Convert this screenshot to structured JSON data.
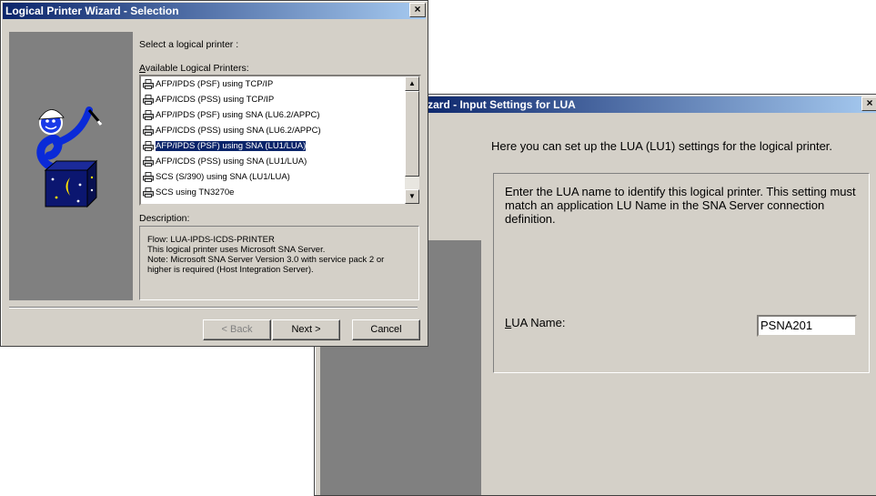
{
  "front_window": {
    "title": "Logical Printer Wizard - Selection",
    "close_glyph": "×",
    "prompt": "Select a logical printer :",
    "list_label_first": "A",
    "list_label_rest": "vailable Logical Printers:",
    "printers": [
      {
        "label": "AFP/IPDS (PSF) using TCP/IP",
        "selected": false
      },
      {
        "label": "AFP/ICDS (PSS) using TCP/IP",
        "selected": false
      },
      {
        "label": "AFP/IPDS (PSF) using SNA (LU6.2/APPC)",
        "selected": false
      },
      {
        "label": "AFP/ICDS (PSS) using SNA (LU6.2/APPC)",
        "selected": false
      },
      {
        "label": "AFP/IPDS (PSF) using SNA (LU1/LUA)",
        "selected": true
      },
      {
        "label": "AFP/ICDS (PSS) using SNA (LU1/LUA)",
        "selected": false
      },
      {
        "label": "SCS (S/390) using SNA (LU1/LUA)",
        "selected": false
      },
      {
        "label": "SCS using TN3270e",
        "selected": false
      }
    ],
    "description_label": "Description:",
    "description_lines": [
      "Flow: LUA-IPDS-ICDS-PRINTER",
      "This logical printer uses Microsoft SNA Server.",
      "Note: Microsoft SNA Server Version 3.0 with service pack 2 or",
      "higher is required (Host Integration Server)."
    ],
    "back_label": "< Back",
    "next_label": "Next >",
    "cancel_label": "Cancel"
  },
  "back_window": {
    "title": "Vizard - Input Settings for LUA",
    "close_glyph": "×",
    "intro": "Here you can set up the LUA (LU1) settings for the logical printer.",
    "instructions": "Enter the LUA name to identify this logical printer. This setting must match an application LU Name in the SNA Server connection definition.",
    "lua_label_first": "L",
    "lua_label_rest": "UA Name:",
    "lua_value": "PSNA201"
  },
  "colors": {
    "title_start": "#0a246a",
    "title_end": "#a6caf0",
    "face": "#d4d0c8",
    "art_bg": "#808080",
    "box": "#0f1b7a",
    "selection": "#0a246a"
  },
  "icons": [
    "close-icon",
    "printer-icon",
    "scroll-up-icon",
    "scroll-down-icon",
    "wizard-illustration"
  ]
}
